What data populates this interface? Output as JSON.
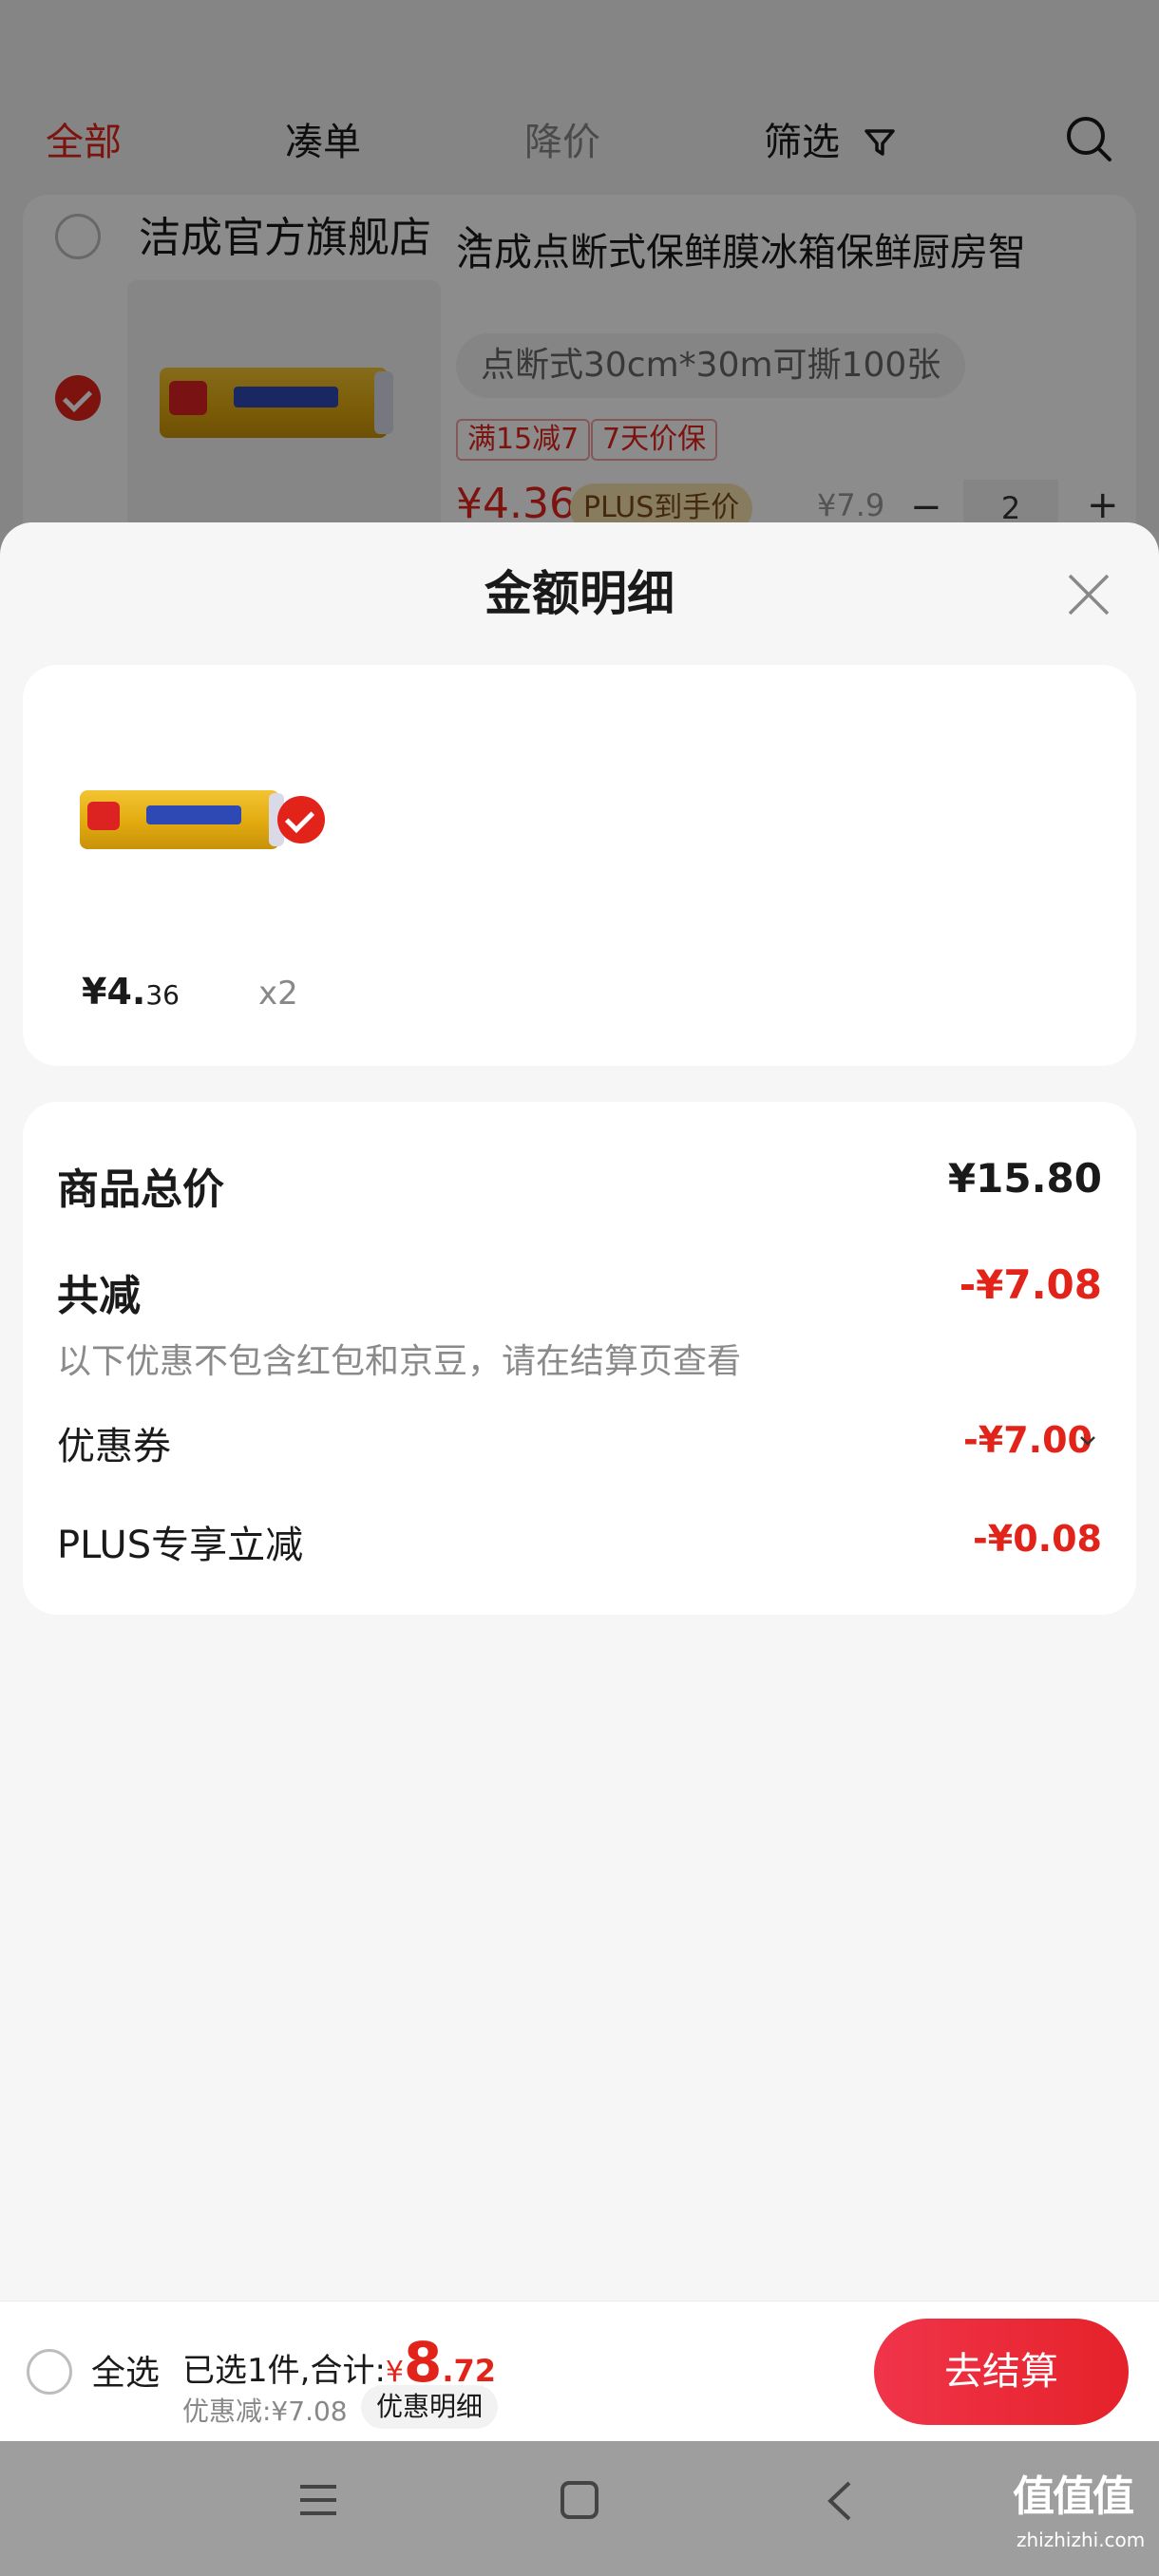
{
  "tabs": [
    {
      "label": "全部"
    },
    {
      "label": "凑单"
    },
    {
      "label": "降价"
    },
    {
      "label": "筛选"
    }
  ],
  "store": {
    "name": "洁成官方旗舰店",
    "item": {
      "title": "洁成点断式保鲜膜冰箱保鲜厨房智",
      "spec": "点断式30cm*30m可撕100张",
      "tags": [
        "满15减7",
        "7天价保"
      ],
      "price": "¥4.36",
      "plus_badge": "PLUS到手价",
      "orig_price": "¥7.9",
      "qty_minus": "−",
      "qty": "2",
      "qty_plus": "+"
    }
  },
  "sheet": {
    "title": "金额明细",
    "product": {
      "price_int": "¥4.",
      "price_dec": "36",
      "qty": "x2"
    },
    "details": {
      "total_label": "商品总价",
      "total_value": "¥15.80",
      "reduce_label": "共减",
      "reduce_value": "-¥7.08",
      "reduce_note": "以下优惠不包含红包和京豆，请在结算页查看",
      "coupon_label": "优惠券",
      "coupon_value": "-¥7.00",
      "plus_label": "PLUS专享立减",
      "plus_value": "-¥0.08"
    }
  },
  "bottom": {
    "select_all": "全选",
    "summary_label": "已选1件,合计:",
    "yen": "¥",
    "total_int": "8",
    "total_dec": ".72",
    "saved": "优惠减:¥7.08",
    "detail_chip": "优惠明细",
    "checkout": "去结算"
  },
  "watermark": {
    "main": "值值值",
    "sub": "zhizhizhi.com"
  }
}
